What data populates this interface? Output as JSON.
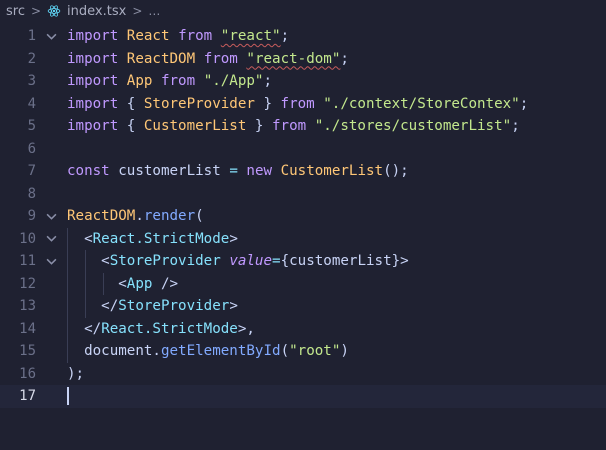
{
  "breadcrumb": {
    "folder": "src",
    "file": "index.tsx"
  },
  "editor": {
    "current_line": 17,
    "lines": [
      {
        "n": "1",
        "tokens": [
          [
            "kw",
            "import"
          ],
          [
            "pun",
            " "
          ],
          [
            "id",
            "React"
          ],
          [
            "pun",
            " "
          ],
          [
            "kw",
            "from"
          ],
          [
            "pun",
            " "
          ],
          [
            "str",
            "\"react\""
          ],
          [
            "pun",
            ";"
          ]
        ]
      },
      {
        "n": "2",
        "tokens": [
          [
            "kw",
            "import"
          ],
          [
            "pun",
            " "
          ],
          [
            "id",
            "ReactDOM"
          ],
          [
            "pun",
            " "
          ],
          [
            "kw",
            "from"
          ],
          [
            "pun",
            " "
          ],
          [
            "str",
            "\"react-dom\""
          ],
          [
            "pun",
            ";"
          ]
        ]
      },
      {
        "n": "3",
        "tokens": [
          [
            "kw",
            "import"
          ],
          [
            "pun",
            " "
          ],
          [
            "id",
            "App"
          ],
          [
            "pun",
            " "
          ],
          [
            "kw",
            "from"
          ],
          [
            "pun",
            " "
          ],
          [
            "str",
            "\"./App\""
          ],
          [
            "pun",
            ";"
          ]
        ]
      },
      {
        "n": "4",
        "tokens": [
          [
            "kw",
            "import"
          ],
          [
            "pun",
            " { "
          ],
          [
            "id",
            "StoreProvider"
          ],
          [
            "pun",
            " } "
          ],
          [
            "kw",
            "from"
          ],
          [
            "pun",
            " "
          ],
          [
            "str",
            "\"./context/StoreContex\""
          ],
          [
            "pun",
            ";"
          ]
        ]
      },
      {
        "n": "5",
        "tokens": [
          [
            "kw",
            "import"
          ],
          [
            "pun",
            " { "
          ],
          [
            "id",
            "CustomerList"
          ],
          [
            "pun",
            " } "
          ],
          [
            "kw",
            "from"
          ],
          [
            "pun",
            " "
          ],
          [
            "str",
            "\"./stores/customerList\""
          ],
          [
            "pun",
            ";"
          ]
        ]
      },
      {
        "n": "6",
        "tokens": []
      },
      {
        "n": "7",
        "tokens": [
          [
            "kw",
            "const"
          ],
          [
            "pun",
            " customerList "
          ],
          [
            "op",
            "="
          ],
          [
            "pun",
            " "
          ],
          [
            "kw",
            "new"
          ],
          [
            "pun",
            " "
          ],
          [
            "id",
            "CustomerList"
          ],
          [
            "pun",
            "();"
          ]
        ]
      },
      {
        "n": "8",
        "tokens": []
      },
      {
        "n": "9",
        "tokens": [
          [
            "id",
            "ReactDOM"
          ],
          [
            "pun",
            "."
          ],
          [
            "fn",
            "render"
          ],
          [
            "pun",
            "("
          ]
        ]
      },
      {
        "n": "10",
        "tokens": [
          [
            "pun",
            "  "
          ],
          [
            "pun",
            "<"
          ],
          [
            "tag",
            "React.StrictMode"
          ],
          [
            "pun",
            ">"
          ]
        ]
      },
      {
        "n": "11",
        "tokens": [
          [
            "pun",
            "    "
          ],
          [
            "pun",
            "<"
          ],
          [
            "tag",
            "StoreProvider"
          ],
          [
            "pun",
            " "
          ],
          [
            "attr",
            "value"
          ],
          [
            "op",
            "="
          ],
          [
            "pun",
            "{customerList}>"
          ]
        ]
      },
      {
        "n": "12",
        "tokens": [
          [
            "pun",
            "      "
          ],
          [
            "pun",
            "<"
          ],
          [
            "tag",
            "App"
          ],
          [
            "pun",
            " />"
          ]
        ]
      },
      {
        "n": "13",
        "tokens": [
          [
            "pun",
            "    "
          ],
          [
            "pun",
            "</"
          ],
          [
            "tag",
            "StoreProvider"
          ],
          [
            "pun",
            ">"
          ]
        ]
      },
      {
        "n": "14",
        "tokens": [
          [
            "pun",
            "  "
          ],
          [
            "pun",
            "</"
          ],
          [
            "tag",
            "React.StrictMode"
          ],
          [
            "pun",
            ">,"
          ]
        ]
      },
      {
        "n": "15",
        "tokens": [
          [
            "pun",
            "  document."
          ],
          [
            "fn",
            "getElementById"
          ],
          [
            "pun",
            "("
          ],
          [
            "str",
            "\"root\""
          ],
          [
            "pun",
            ")"
          ]
        ]
      },
      {
        "n": "16",
        "tokens": [
          [
            "pun",
            ");"
          ]
        ]
      },
      {
        "n": "17",
        "tokens": []
      }
    ]
  },
  "colors": {
    "background": "#1f2131",
    "keyword": "#c099ff",
    "identifier": "#ffc777",
    "string": "#c3e88d",
    "tag": "#86e1fc",
    "function": "#82aaff"
  },
  "icons": {
    "file_icon": "react-icon",
    "fold_icon": "chevron-down-icon"
  }
}
